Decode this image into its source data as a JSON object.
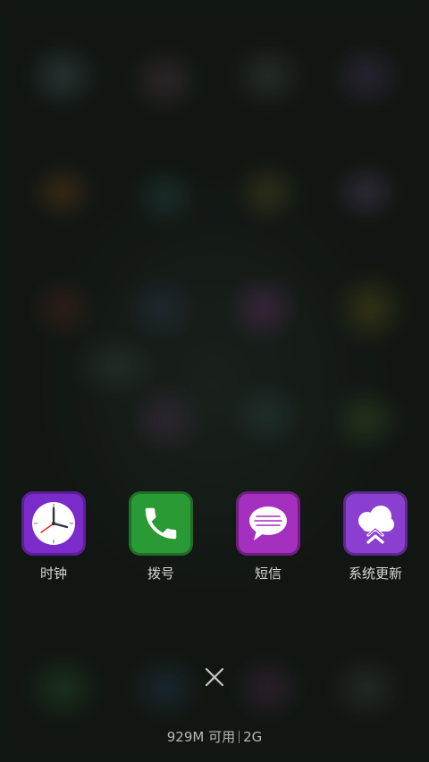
{
  "recent_apps": [
    {
      "id": "clock",
      "label": "时钟",
      "icon": "clock-icon",
      "tile_color": "#7a2bc9",
      "border_color": "#5a1f96"
    },
    {
      "id": "dialer",
      "label": "拨号",
      "icon": "phone-icon",
      "tile_color": "#2a9a34",
      "border_color": "#1f6e27"
    },
    {
      "id": "messages",
      "label": "短信",
      "icon": "message-bubble-icon",
      "tile_color": "#a52fbe",
      "border_color": "#6e1f80"
    },
    {
      "id": "system_update",
      "label": "系统更新",
      "icon": "cloud-update-icon",
      "tile_color": "#8b3fd0",
      "border_color": "#5b2a8a"
    }
  ],
  "close_button": {
    "icon": "close-icon"
  },
  "memory": {
    "available": "929M 可用",
    "total": "2G"
  }
}
